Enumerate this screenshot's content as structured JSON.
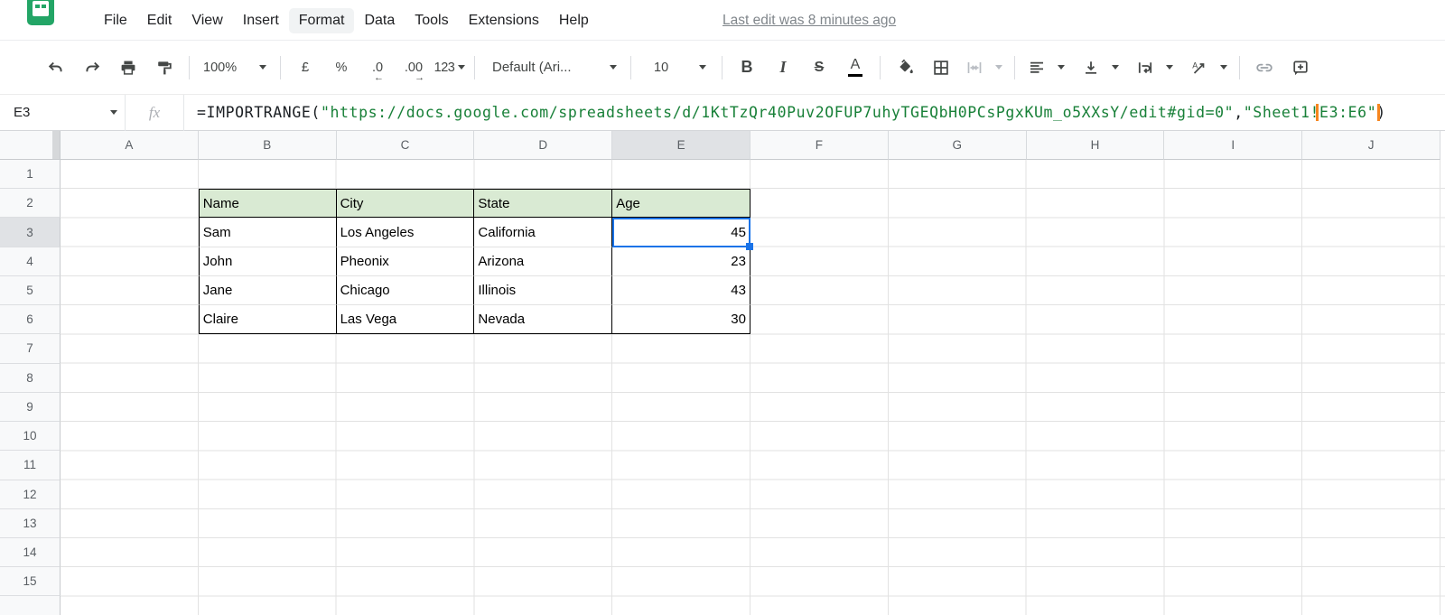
{
  "menubar": {
    "items": [
      "File",
      "Edit",
      "View",
      "Insert",
      "Format",
      "Data",
      "Tools",
      "Extensions",
      "Help"
    ],
    "active_item": "Format",
    "last_edit_status": "Last edit was 8 minutes ago"
  },
  "toolbar": {
    "icons": [
      "undo",
      "redo",
      "print",
      "paint-format",
      "fill-color",
      "borders",
      "merge-cells",
      "horizontal-align",
      "vertical-align",
      "text-wrapping",
      "text-rotation",
      "insert-link",
      "insert-comment"
    ],
    "zoom_value": "100%",
    "currency_label": "£",
    "percent_label": "%",
    "decrease_decimal_label": ".0",
    "decrease_decimal_arrow": "←",
    "increase_decimal_label": ".00",
    "increase_decimal_arrow": "→",
    "more_formats_label": "123",
    "font_name": "Default (Ari...",
    "font_size": "10",
    "bold_label": "B",
    "italic_label": "I",
    "strikethrough_label": "S",
    "text_color_label": "A"
  },
  "formula_bar": {
    "name_box_value": "E3",
    "fx_label": "fx",
    "formula": {
      "prefix": "=IMPORTRANGE(",
      "url_string": "\"https://docs.google.com/spreadsheets/d/1KtTzQr40Puv2OFUP7uhyTGEQbH0PCsPgxKUm_o5XXsY/edit#gid=0\"",
      "separator": ",",
      "sheet_string": "\"Sheet1!",
      "highlighted_range": "E3:E6\"",
      "suffix": ")"
    }
  },
  "grid": {
    "column_headers": [
      "A",
      "B",
      "C",
      "D",
      "E",
      "F",
      "G",
      "H",
      "I",
      "J"
    ],
    "selected_column": "E",
    "row_headers": [
      "1",
      "2",
      "3",
      "4",
      "5",
      "6",
      "7",
      "8",
      "9",
      "10",
      "11",
      "12",
      "13",
      "14",
      "15"
    ],
    "selected_row": "3",
    "selected_cell": "E3",
    "selected_cell_value": "45",
    "table": {
      "headers": [
        "Name",
        "City",
        "State",
        "Age"
      ],
      "rows": [
        [
          "Sam",
          "Los Angeles",
          "California",
          "45"
        ],
        [
          "John",
          "Pheonix",
          "Arizona",
          "23"
        ],
        [
          "Jane",
          "Chicago",
          "Illinois",
          "43"
        ],
        [
          "Claire",
          "Las Vega",
          "Nevada",
          "30"
        ]
      ]
    }
  },
  "colors": {
    "table_header_fill": "#d9ead3",
    "selection_blue": "#1a73e8",
    "formula_string_green": "#188038",
    "range_highlight_orange": "#f6861f",
    "header_selected_gray": "#e0e2e5"
  }
}
